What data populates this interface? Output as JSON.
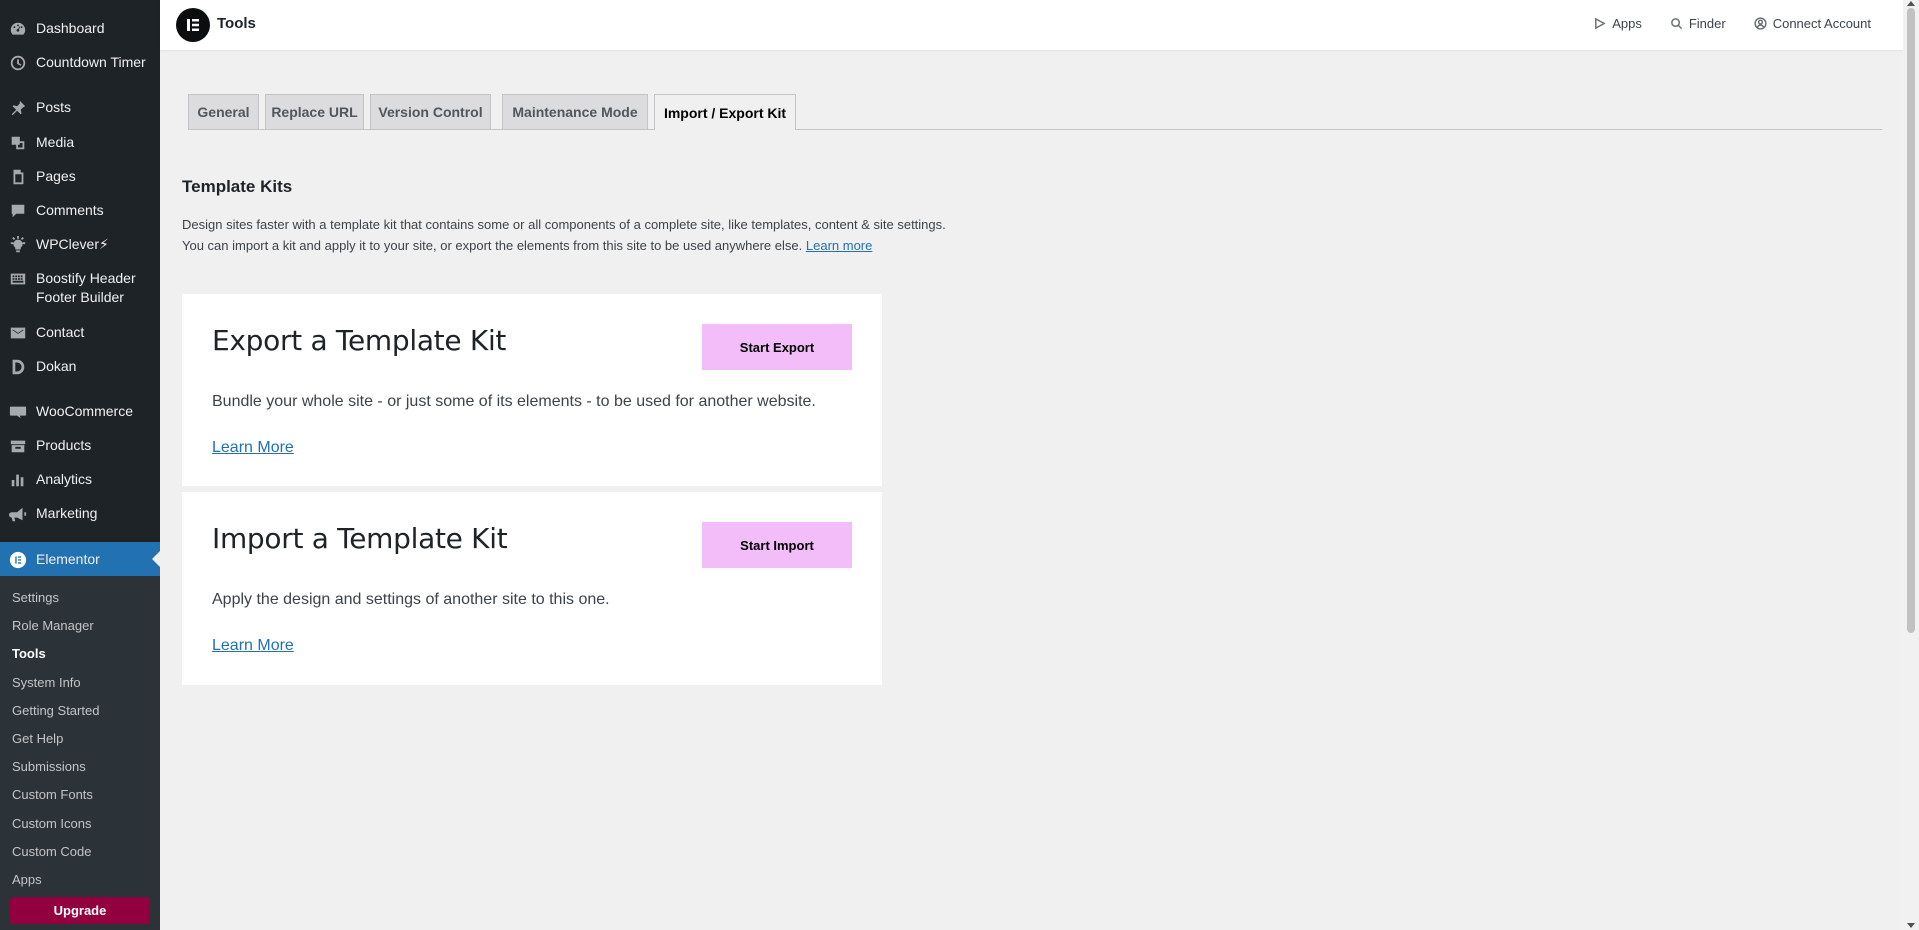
{
  "sidebar": {
    "items": [
      {
        "label": "Dashboard",
        "icon": "dashboard-icon"
      },
      {
        "label": "Countdown Timer",
        "icon": "clock-icon"
      },
      {
        "label": "Posts",
        "icon": "pin-icon"
      },
      {
        "label": "Media",
        "icon": "media-icon"
      },
      {
        "label": "Pages",
        "icon": "pages-icon"
      },
      {
        "label": "Comments",
        "icon": "comment-icon"
      },
      {
        "label": "WPClever⚡",
        "icon": "lightbulb-icon"
      },
      {
        "label": "Boostify Header Footer Builder",
        "icon": "grid-icon"
      },
      {
        "label": "Contact",
        "icon": "mail-icon"
      },
      {
        "label": "Dokan",
        "icon": "dokan-icon"
      },
      {
        "label": "WooCommerce",
        "icon": "woo-icon"
      },
      {
        "label": "Products",
        "icon": "box-icon"
      },
      {
        "label": "Analytics",
        "icon": "bar-chart-icon"
      },
      {
        "label": "Marketing",
        "icon": "megaphone-icon"
      },
      {
        "label": "Elementor",
        "icon": "elementor-icon"
      }
    ],
    "submenu": [
      "Settings",
      "Role Manager",
      "Tools",
      "System Info",
      "Getting Started",
      "Get Help",
      "Submissions",
      "Custom Fonts",
      "Custom Icons",
      "Custom Code",
      "Apps"
    ],
    "current_sub": "Tools",
    "upgrade": "Upgrade"
  },
  "topbar": {
    "title": "Tools",
    "actions": [
      {
        "label": "Apps",
        "icon": "play-icon"
      },
      {
        "label": "Finder",
        "icon": "search-icon"
      },
      {
        "label": "Connect Account",
        "icon": "user-circle-icon"
      }
    ]
  },
  "tabs": [
    "General",
    "Replace URL",
    "Version Control",
    "Maintenance Mode",
    "Import / Export Kit"
  ],
  "active_tab": "Import / Export Kit",
  "section": {
    "title": "Template Kits",
    "line1": "Design sites faster with a template kit that contains some or all components of a complete site, like templates, content & site settings.",
    "line2": "You can import a kit and apply it to your site, or export the elements from this site to be used anywhere else.",
    "link": "Learn more"
  },
  "export_card": {
    "title": "Export a Template Kit",
    "button": "Start Export",
    "text": "Bundle your whole site - or just some of its elements - to be used for another website.",
    "link": "Learn More"
  },
  "import_card": {
    "title": "Import a Template Kit",
    "button": "Start Import",
    "text": "Apply the design and settings of another site to this one.",
    "link": "Learn More"
  },
  "colors": {
    "sidebar_bg": "#1d2327",
    "submenu_bg": "#2c3338",
    "active_blue": "#2271b1",
    "upgrade": "#93003f",
    "card_button": "#f2bdf8"
  }
}
